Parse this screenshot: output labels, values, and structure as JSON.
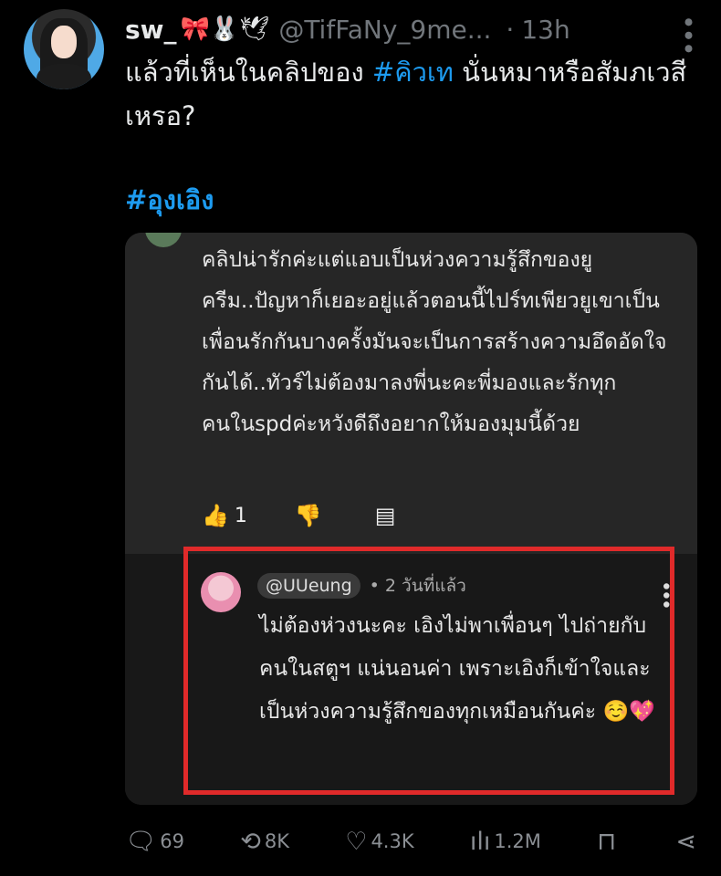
{
  "tweet": {
    "username": "sw_",
    "username_emojis": "🎀🐰🕊",
    "handle": "@TifFaNy_9me...",
    "time": "13h",
    "text_part1": "แล้วที่เห็นในคลิปของ ",
    "hashtag1": "#คิวเท",
    "text_part2": " นั่นหมาหรือสัมภเวสีเหรอ?",
    "hashtag2": "#อุงเอิง"
  },
  "screenshot": {
    "comment_text": "คลิปน่ารักค่ะแต่แอบเป็นห่วงความรู้สึกของยูครีม..ปัญหาก็เยอะอยู่แล้วตอนนี้ไปร์ทเพียวยูเขาเป็นเพื่อนรักกันบางครั้งมันจะเป็นการสร้างความอึดอัดใจกันได้..ทัวร์ไม่ต้องมาลงพี่นะคะพี่มองและรักทุกคนในspdค่ะหวังดีถึงอยากให้มองมุมนี้ด้วย",
    "comment_likes": "1",
    "reply_user": "@UUeung",
    "reply_time": "• 2 วันที่แล้ว",
    "reply_text": "ไม่ต้องห่วงนะคะ เอิงไม่พาเพื่อนๆ ไปถ่ายกับคนในสตูฯ แน่นอนค่า เพราะเอิงก็เข้าใจและเป็นห่วงความรู้สึกของทุกเหมือนกันค่ะ ☺️💖"
  },
  "stats": {
    "replies": "69",
    "reposts": "8K",
    "likes": "4.3K",
    "views": "1.2M"
  },
  "colors": {
    "accent": "#1d9bf0",
    "highlight_border": "#e02a2a"
  }
}
